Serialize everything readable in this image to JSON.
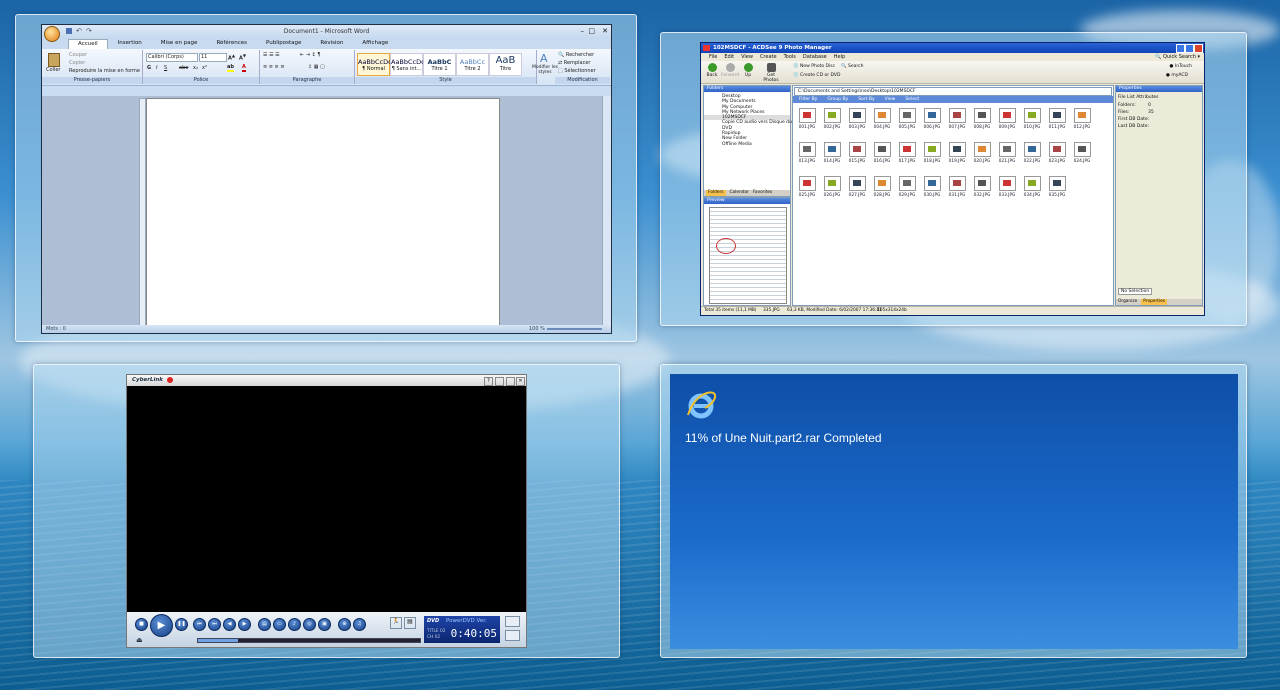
{
  "word": {
    "title": "Document1 - Microsoft Word",
    "tabs": [
      "Accueil",
      "Insertion",
      "Mise en page",
      "Références",
      "Publipostage",
      "Révision",
      "Affichage"
    ],
    "clipboard": {
      "paste": "Coller",
      "cut": "Couper",
      "copy": "Copier",
      "format": "Reproduire la mise en forme",
      "label": "Presse-papiers"
    },
    "font": {
      "name": "Calibri (Corps)",
      "size": "11",
      "label": "Police"
    },
    "paragraph_label": "Paragraphe",
    "styles": [
      {
        "preview": "AaBbCcDc",
        "name": "¶ Normal"
      },
      {
        "preview": "AaBbCcDc",
        "name": "¶ Sans int..."
      },
      {
        "preview": "AaBbC",
        "name": "Titre 1"
      },
      {
        "preview": "AaBbCc",
        "name": "Titre 2"
      },
      {
        "preview": "AaB",
        "name": "Titre"
      }
    ],
    "change_styles": "Modifier les styles",
    "style_label": "Style",
    "editing": {
      "find": "Rechercher",
      "replace": "Remplacer",
      "select": "Sélectionner",
      "label": "Modification"
    },
    "status": "Mots : 0",
    "zoom": "100 %"
  },
  "acdsee": {
    "title": "102MSDCF - ACDSee 9 Photo Manager",
    "menu": [
      "File",
      "Edit",
      "View",
      "Create",
      "Tools",
      "Database",
      "Help"
    ],
    "quick_search": "Quick Search",
    "tools": {
      "back": "Back",
      "forward": "Forward",
      "up": "Up",
      "get_photos": "Get Photos",
      "new_photo_disc": "New Photo Disc",
      "create_cd": "Create CD or DVD",
      "search": "Search",
      "intouch": "InTouch",
      "myacd": "myACD"
    },
    "folders_title": "Folders",
    "tree": [
      "Desktop",
      "My Documents",
      "My Computer",
      "My Network Places",
      "102MSDCF",
      "Copie CD audio vers Disque dur",
      "DVD",
      "Rapidup",
      "New Folder",
      "Offline Media"
    ],
    "pane_tabs": [
      "Folders",
      "Calendar",
      "Favorites"
    ],
    "preview_title": "Preview",
    "path": "C:\\Documents and Settings\\neo\\Desktop\\102MSDCF",
    "filters": {
      "filter": "Filter By",
      "group": "Group By",
      "sort": "Sort By",
      "view": "View",
      "select": "Select"
    },
    "thumbs": [
      "001.JPG",
      "002.JPG",
      "003.JPG",
      "004.JPG",
      "005.JPG",
      "006.JPG",
      "007.JPG",
      "008.JPG",
      "009.JPG",
      "010.JPG",
      "011.JPG",
      "012.JPG",
      "013.JPG",
      "014.JPG",
      "015.JPG",
      "016.JPG",
      "017.JPG",
      "018.JPG",
      "019.JPG",
      "020.JPG",
      "021.JPG",
      "022.JPG",
      "023.JPG",
      "024.JPG",
      "025.JPG",
      "026.JPG",
      "027.JPG",
      "028.JPG",
      "029.JPG",
      "030.JPG",
      "031.JPG",
      "032.JPG",
      "033.JPG",
      "034.JPG",
      "035.JPG"
    ],
    "properties_title": "Properties",
    "props_header": "File List Attributes",
    "props": [
      {
        "k": "Folders:",
        "v": "0"
      },
      {
        "k": "Files:",
        "v": "35"
      },
      {
        "k": "First DB Date:",
        "v": ""
      },
      {
        "k": "Last DB Date:",
        "v": ""
      }
    ],
    "no_selection": "No Selection",
    "prop_tabs": [
      "Organize",
      "Properties"
    ],
    "status": [
      "Total 35 items  (11,1 MB)",
      "335.JPG",
      "63,3 KB, Modified Date: 6/02/2007 17:36:51",
      "405x314x24b"
    ]
  },
  "powerdvd": {
    "brand": "CyberLink",
    "lcd_title": "PowerDVD Ver.",
    "time": "0:40:05",
    "title_num": "TITLE  02",
    "chapter_num": "CH  02",
    "progress": 0.18
  },
  "ie": {
    "message": "11% of Une Nuit.part2.rar Completed"
  }
}
